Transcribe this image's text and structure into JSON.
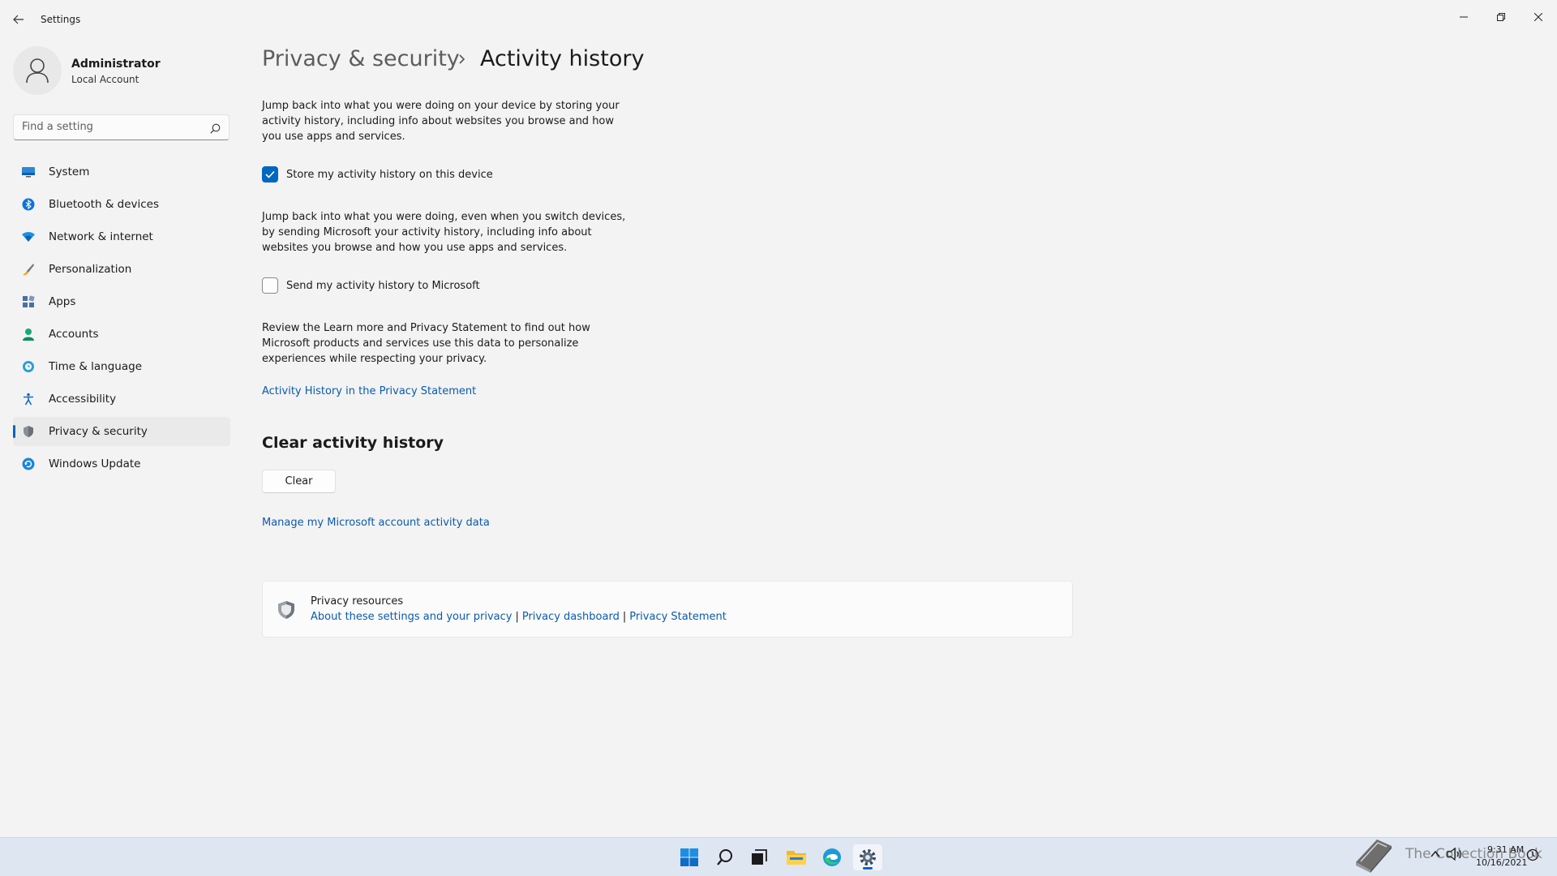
{
  "window": {
    "title": "Settings"
  },
  "account": {
    "name": "Administrator",
    "type": "Local Account"
  },
  "search": {
    "placeholder": "Find a setting"
  },
  "sidebar": {
    "items": [
      {
        "label": "System",
        "icon": "monitor-icon"
      },
      {
        "label": "Bluetooth & devices",
        "icon": "bluetooth-icon"
      },
      {
        "label": "Network & internet",
        "icon": "wifi-icon"
      },
      {
        "label": "Personalization",
        "icon": "brush-icon"
      },
      {
        "label": "Apps",
        "icon": "apps-icon"
      },
      {
        "label": "Accounts",
        "icon": "person-icon"
      },
      {
        "label": "Time & language",
        "icon": "globe-clock-icon"
      },
      {
        "label": "Accessibility",
        "icon": "accessibility-icon"
      },
      {
        "label": "Privacy & security",
        "icon": "shield-icon",
        "active": true
      },
      {
        "label": "Windows Update",
        "icon": "update-icon"
      }
    ]
  },
  "breadcrumb": {
    "parent": "Privacy & security",
    "current": "Activity history"
  },
  "main": {
    "para1": "Jump back into what you were doing on your device by storing your activity history, including info about websites you browse and how you use apps and services.",
    "checkbox1": {
      "label": "Store my activity history on this device",
      "checked": true
    },
    "para2": "Jump back into what you were doing, even when you switch devices, by sending Microsoft your activity history, including info about websites you browse and how you use apps and services.",
    "checkbox2": {
      "label": "Send my activity history to Microsoft",
      "checked": false
    },
    "para3": "Review the Learn more and Privacy Statement to find out how Microsoft products and services use this data to personalize experiences while respecting your privacy.",
    "link_activity": "Activity History in the Privacy Statement",
    "clear_section_title": "Clear activity history",
    "clear_button": "Clear",
    "link_manage": "Manage my Microsoft account activity data"
  },
  "resources": {
    "title": "Privacy resources",
    "links": [
      "About these settings and your privacy",
      "Privacy dashboard",
      "Privacy Statement"
    ],
    "separator": "|"
  },
  "taskbar": {
    "watermark": "The Collection Book",
    "time": "9:31 AM",
    "date": "10/16/2021"
  },
  "colors": {
    "accent": "#0067c0",
    "link": "#0a5bad",
    "background": "#f3f3f3"
  }
}
